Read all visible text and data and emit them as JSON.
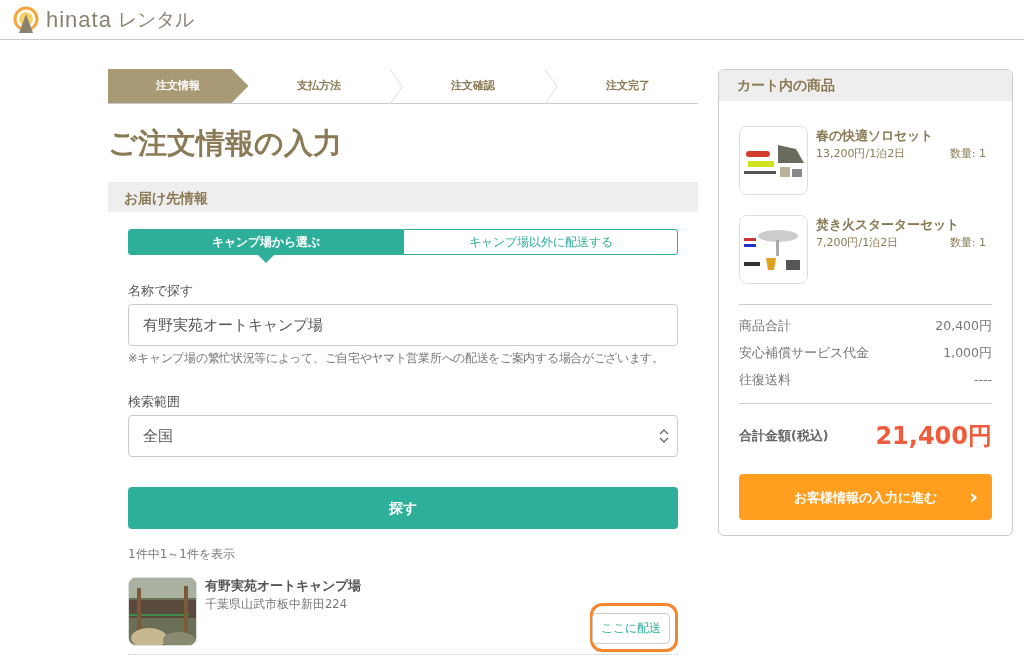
{
  "header": {
    "logo_text": "hinata",
    "logo_suffix": "レンタル"
  },
  "steps": [
    {
      "label": "注文情報",
      "selected": true
    },
    {
      "label": "支払方法",
      "selected": false
    },
    {
      "label": "注文確認",
      "selected": false
    },
    {
      "label": "注文完了",
      "selected": false
    }
  ],
  "page_title": "ご注文情報の入力",
  "section_title": "お届け先情報",
  "delivery_tabs": [
    {
      "label": "キャンプ場から選ぶ",
      "selected": true
    },
    {
      "label": "キャンプ場以外に配送する",
      "selected": false
    }
  ],
  "name_search": {
    "label": "名称で探す",
    "value": "有野実苑オートキャンプ場",
    "note": "※キャンプ場の繁忙状況等によって、ご自宅やヤマト営業所への配送をご案内する場合がございます。"
  },
  "area": {
    "label": "検索範囲",
    "value": "全国"
  },
  "search_button": "探す",
  "result_count": "1件中1～1件を表示",
  "results": [
    {
      "name": "有野実苑オートキャンプ場",
      "address": "千葉県山武市板中新田224",
      "button": "ここに配送",
      "highlighted": true
    }
  ],
  "cart": {
    "title": "カート内の商品",
    "items": [
      {
        "name": "春の快適ソロセット",
        "price": "13,200円/1泊2日",
        "quantity": "数量: 1"
      },
      {
        "name": "焚き火スターターセット",
        "price": "7,200円/1泊2日",
        "quantity": "数量: 1"
      }
    ],
    "summary": [
      {
        "label": "商品合計",
        "value": "20,400円"
      },
      {
        "label": "安心補償サービス代金",
        "value": "1,000円"
      },
      {
        "label": "往復送料",
        "value": "----"
      }
    ],
    "total_label": "合計金額(税込)",
    "total_value": "21,400円",
    "checkout_button": "お客様情報の入力に進む",
    "checkout_arrow": "›"
  }
}
